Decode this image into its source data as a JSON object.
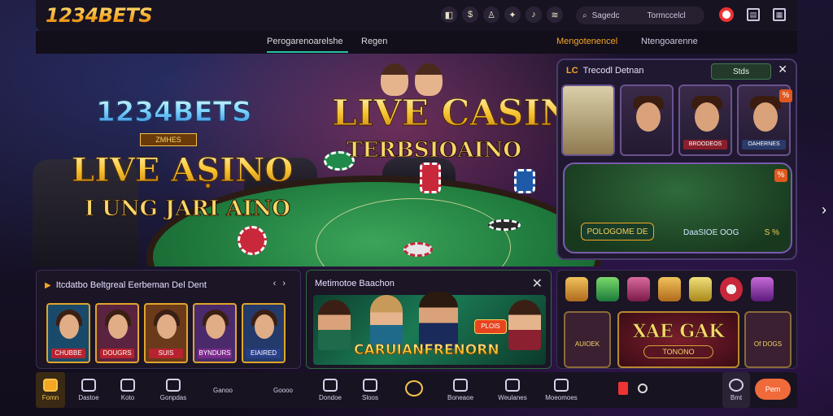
{
  "header": {
    "logo": "1234BETS",
    "icons": [
      "chart-icon",
      "share-icon",
      "bell-icon",
      "gift-icon",
      "trophy-icon",
      "star-icon"
    ],
    "icon_glyphs": [
      "◧",
      "$",
      "♙",
      "✦",
      "♪",
      "≋"
    ],
    "search_label": "Sagedc",
    "search_value": "Tormccelcl",
    "right_icons": [
      "flag-icon",
      "wallet-icon",
      "menu-icon"
    ]
  },
  "subnav": {
    "tab_active": "Perogarenoarelshe",
    "tab_2": "Regen",
    "tab_orange": "Mengotenencel",
    "tab_right": "Ntengoarenne"
  },
  "hero": {
    "brand": "1234BETS",
    "brand_ribbon": "ZMHES",
    "live_text": "LIVE AṢINO",
    "live_sub": "I UNG JARI AINO",
    "title": "LIVE CASINO",
    "subtitle": "TERBSIOAINO"
  },
  "live_panel": {
    "brand": "LC",
    "title": "Trecodl Detnan",
    "tab": "Stds",
    "thumb_tags": [
      "",
      "BROODEOS",
      "OAHERNES"
    ],
    "badge": "%",
    "button_left": "POLOGOME DE",
    "label_center": "DaaSIOE OOG",
    "label_right": "S %"
  },
  "panel_players": {
    "title": "Itcdatbo Beltgreal Eerbeman Del Dent",
    "cards": [
      {
        "caption": "CHUBBE",
        "bg": "#1a4a6a",
        "cap_color": "#b8232f"
      },
      {
        "caption": "DOUGRS",
        "bg": "#5a2340",
        "cap_color": "#b8232f"
      },
      {
        "caption": "SUIS",
        "bg": "#6a3a1a",
        "cap_color": "#b8232f"
      },
      {
        "caption": "BYNDURS",
        "bg": "#4a2a6a",
        "cap_color": "#7a2a8a"
      },
      {
        "caption": "EIAIRED",
        "bg": "#233a6a",
        "cap_color": "#2a3f8a"
      }
    ]
  },
  "panel_promo": {
    "title": "Metimotoe Baachon",
    "badge": "PLOIS",
    "promo_text": "CARUIANFRENORN"
  },
  "panel_slots": {
    "big_title": "XAE GAK",
    "big_sub": "TONONO",
    "left_label": "AUIOEK",
    "right_label": "Of DOGS"
  },
  "bottomnav": {
    "items": [
      {
        "label": "Fomn",
        "name": "nav-home"
      },
      {
        "label": "Dastoe",
        "name": "nav-dastoe"
      },
      {
        "label": "Koto",
        "name": "nav-koto"
      },
      {
        "label": "Gonpdas",
        "name": "nav-gonpdas"
      },
      {
        "label": "Ganoo",
        "name": "nav-ganoo"
      },
      {
        "label": "Goooo",
        "name": "nav-goooo"
      },
      {
        "label": "Dondoe",
        "name": "nav-dondoe"
      },
      {
        "label": "Sloos",
        "name": "nav-sloos"
      },
      {
        "label": "Boneaoe",
        "name": "nav-boneaoe"
      },
      {
        "label": "Weulanes",
        "name": "nav-weulanes"
      },
      {
        "label": "Moeomoes",
        "name": "nav-moeomoes"
      },
      {
        "label": "Bmt",
        "name": "nav-bmt"
      }
    ],
    "right_button": "Pem"
  },
  "colors": {
    "accent": "#f5a623",
    "teal": "#28c2a6",
    "cta": "#f06a3a",
    "felt": "#1f7a3d"
  }
}
